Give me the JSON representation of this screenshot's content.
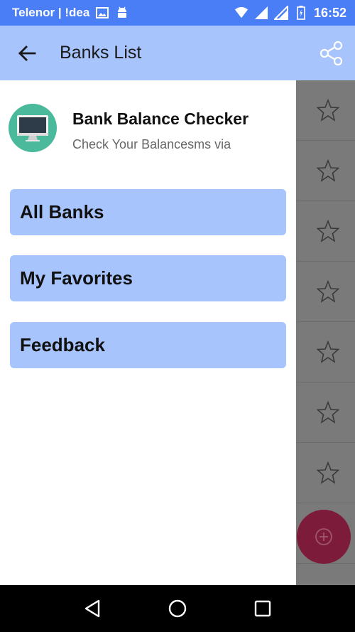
{
  "status_bar": {
    "carrier": "Telenor | !dea",
    "time": "16:52"
  },
  "app_bar": {
    "title": "Banks List"
  },
  "drawer": {
    "app_name": "Bank Balance Checker",
    "app_subtitle": "Check Your Balancesms via",
    "menu_items": [
      {
        "label": "All Banks"
      },
      {
        "label": "My Favorites"
      },
      {
        "label": "Feedback"
      }
    ]
  },
  "colors": {
    "status_bar": "#4a7ef7",
    "app_bar": "#a8c4fd",
    "menu_button": "#a8c4fd",
    "logo_bg": "#4ab99c",
    "fab": "#7d1b3a",
    "scrim_list": "#7a7a7a"
  },
  "icons": {
    "back": "arrow-left-icon",
    "share": "share-icon",
    "star": "star-outline-icon",
    "fab": "add-circle-icon",
    "nav_back": "triangle-back-icon",
    "nav_home": "circle-home-icon",
    "nav_recents": "square-recents-icon"
  }
}
